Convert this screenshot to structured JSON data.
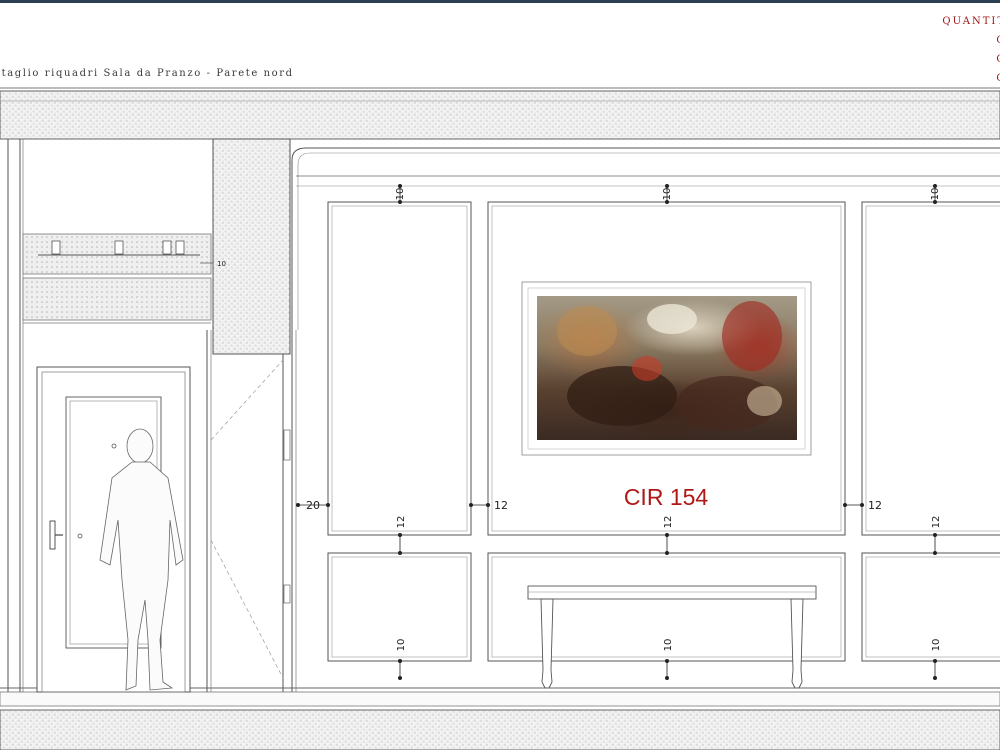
{
  "title": "ttaglio riquadri Sala da Pranzo - Parete nord",
  "quantities": [
    "QUANTIT",
    "C",
    "C",
    "C"
  ],
  "code": "CIR 154",
  "dimensions": {
    "top_left": "10",
    "top_center": "10",
    "top_right": "10",
    "left_gap": "20",
    "gap_left_center": "12",
    "gap_center_right": "12",
    "mid_left": "12",
    "mid_center": "12",
    "mid_right": "12",
    "bottom_left": "10",
    "bottom_center": "10",
    "bottom_right": "10",
    "header_side": "10"
  },
  "colors": {
    "accent": "#a01414",
    "line": "#555555",
    "hatch": "#bdbdbd"
  }
}
